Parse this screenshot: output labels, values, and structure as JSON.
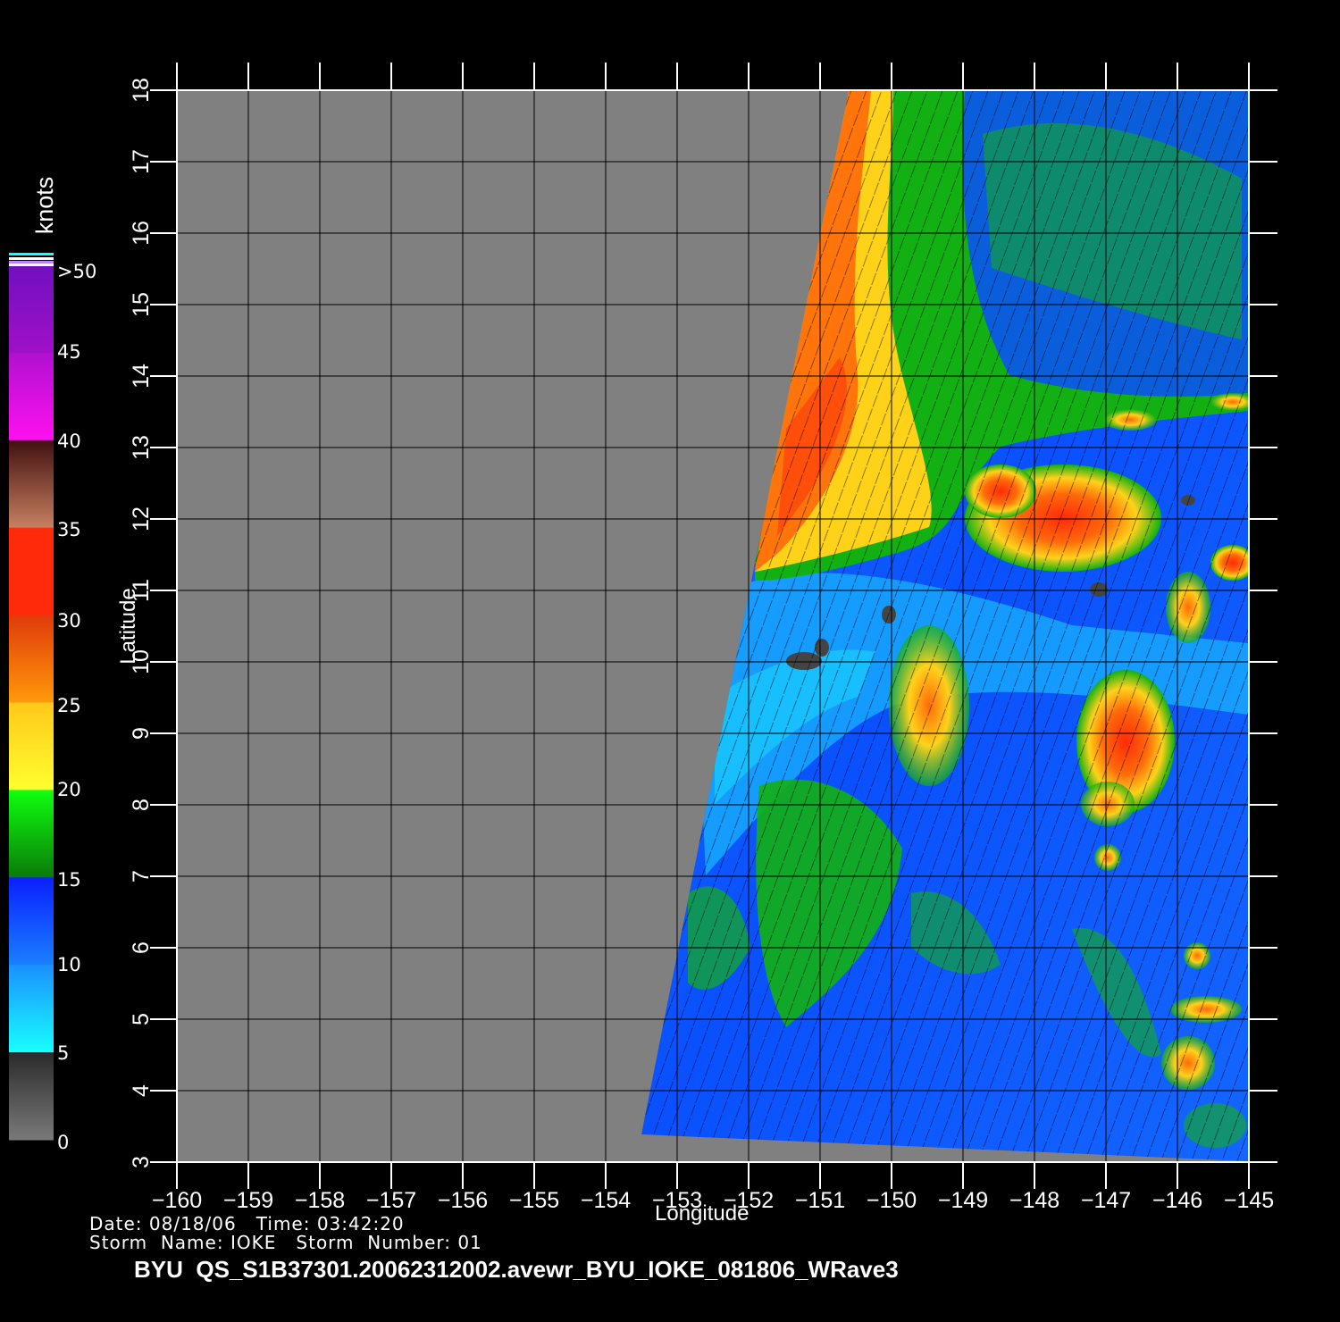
{
  "map": {
    "xlabel": "Longitude",
    "ylabel": "Latitude",
    "xlim": [
      -160,
      -145
    ],
    "ylim": [
      3,
      18
    ],
    "x_ticks": [
      "−160",
      "−159",
      "−158",
      "−157",
      "−156",
      "−155",
      "−154",
      "−153",
      "−152",
      "−151",
      "−150",
      "−149",
      "−148",
      "−147",
      "−146",
      "−145"
    ],
    "y_ticks": [
      "3",
      "4",
      "5",
      "6",
      "7",
      "8",
      "9",
      "10",
      "11",
      "12",
      "13",
      "14",
      "15",
      "16",
      "17",
      "18"
    ],
    "grid": true,
    "no_data_color": "#808080"
  },
  "colorbar": {
    "title": "knots",
    "labels": [
      ">50",
      "45",
      "40",
      "35",
      "30",
      "25",
      "20",
      "15",
      "10",
      "5",
      "0"
    ],
    "colors": {
      "0_5": "#6a6a6a",
      "5_10": "#18c8ff",
      "10_15": "#0a50ff",
      "15_20": "#12b012",
      "20_25": "#ffd21a",
      "25_30": "#ff6a0a",
      "30_35": "#ff2a0a",
      "35_40": "#8a4030",
      "40_45": "#e010e0",
      "45_50": "#7010c0"
    }
  },
  "info": {
    "date_line": "Date: 08/18/06   Time: 03:42:20",
    "storm_line": "Storm  Name: IOKE   Storm  Number: 01",
    "filename": "BYU  QS_S1B37301.20062312002.avewr_BYU_IOKE_081806_WRave3"
  }
}
